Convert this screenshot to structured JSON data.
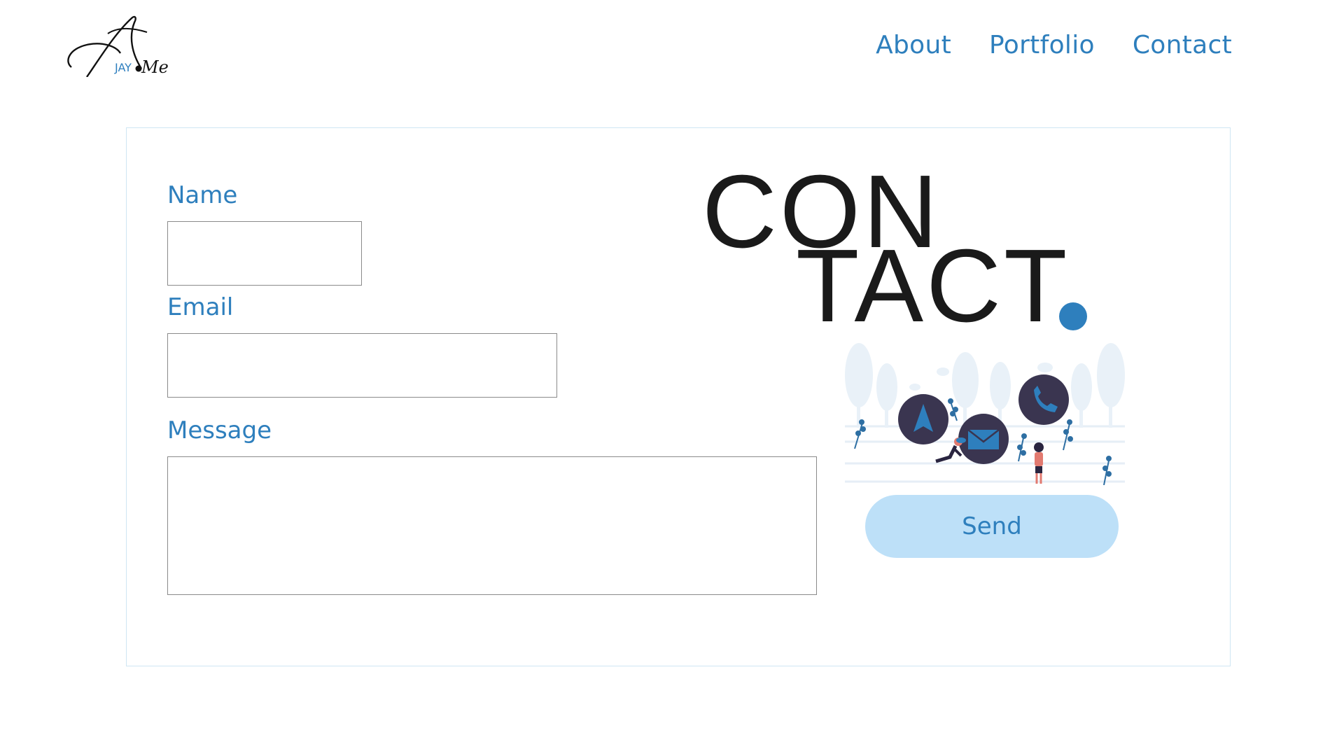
{
  "header": {
    "logo": {
      "letter": "A",
      "small_text": "JAY",
      "suffix": "Me"
    },
    "nav": [
      {
        "label": "About"
      },
      {
        "label": "Portfolio"
      },
      {
        "label": "Contact"
      }
    ]
  },
  "form": {
    "name_label": "Name",
    "name_value": "",
    "email_label": "Email",
    "email_value": "",
    "message_label": "Message",
    "message_value": "",
    "send_label": "Send"
  },
  "contact_title": {
    "line1": "CON",
    "line2": "TACT"
  },
  "colors": {
    "accent": "#2e7fbd",
    "button_bg": "#bde0f8",
    "title_text": "#1a1a1a",
    "card_border": "#cfe6f3",
    "icon_circle": "#3a3550"
  },
  "illustration_icons": [
    "navigation-arrow-icon",
    "envelope-icon",
    "phone-icon"
  ]
}
